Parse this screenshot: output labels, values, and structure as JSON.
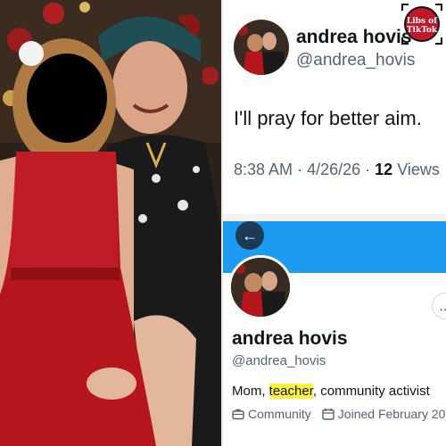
{
  "tweet": {
    "display_name": "andrea hovis",
    "handle": "@andrea_hovis",
    "text": "I'll pray for better aim.",
    "time": "8:38 AM",
    "date": "4/26/26",
    "views_count": "12",
    "views_label": "Views",
    "separator": "·"
  },
  "watermark": {
    "text_line1": "Libs of",
    "text_line2": "TikTok"
  },
  "profile": {
    "back_icon": "←",
    "more_icon": "…",
    "display_name": "andrea hovis",
    "handle": "@andrea_hovis",
    "bio_before": "Mom, ",
    "bio_highlight": "teacher",
    "bio_after": ", community activist",
    "category": "Community",
    "joined": "Joined February 20"
  },
  "colors": {
    "accent": "#1d9bf0",
    "highlight": "#fff13a",
    "watermark_red": "#c0172d"
  }
}
